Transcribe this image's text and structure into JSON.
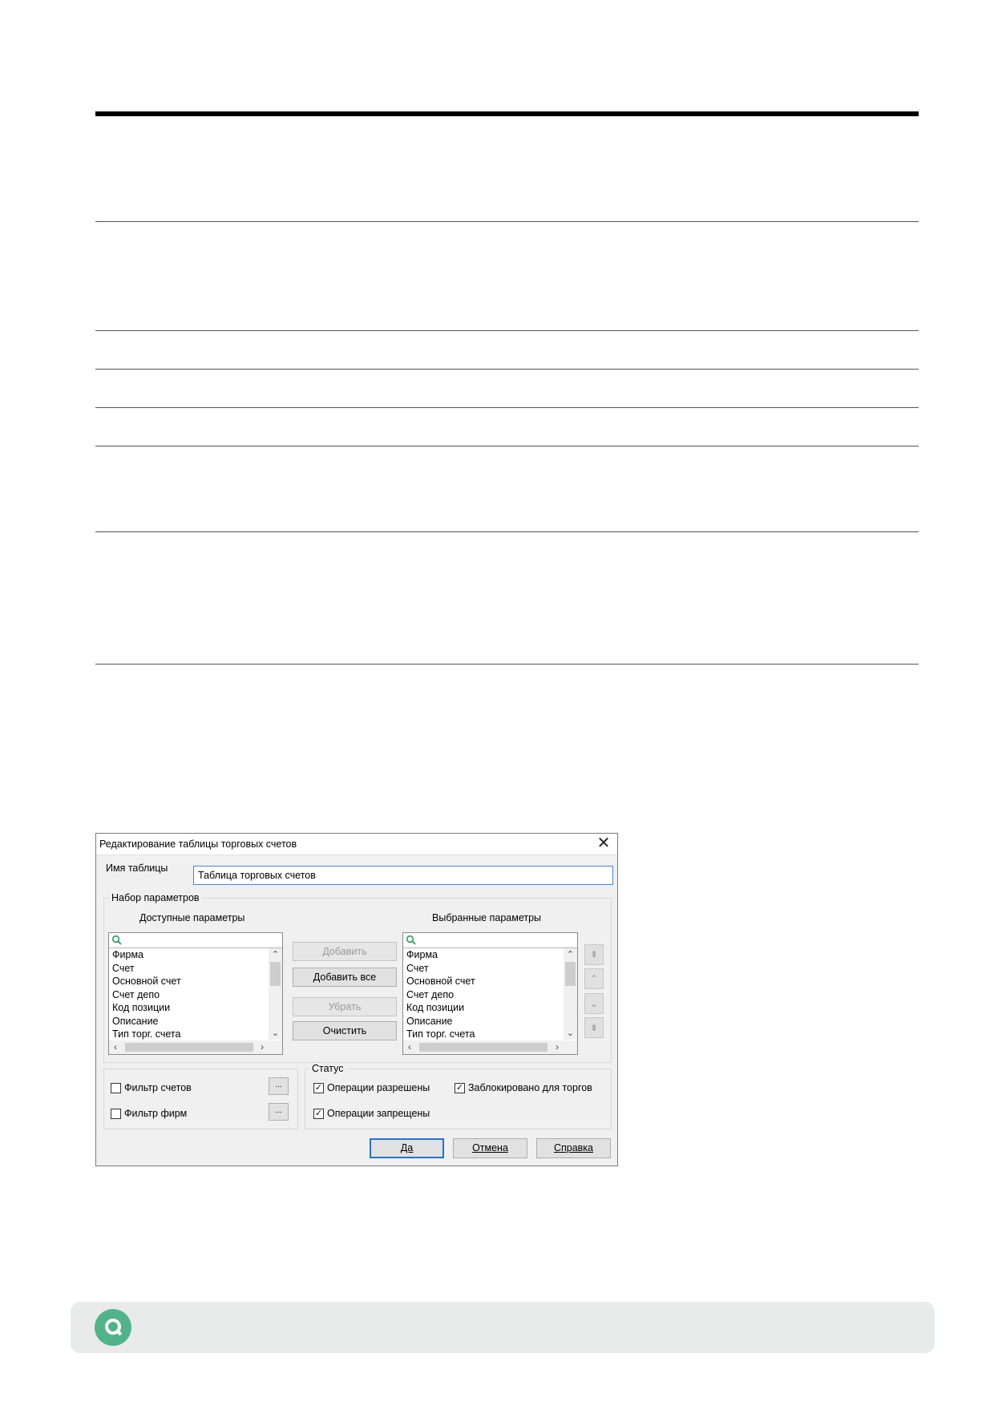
{
  "dialog": {
    "title": "Редактирование таблицы торговых счетов",
    "close_icon": "close-icon",
    "table_name_label": "Имя таблицы",
    "table_name_value": "Таблица торговых счетов",
    "params_group_label": "Набор параметров",
    "available_label": "Доступные параметры",
    "selected_label": "Выбранные параметры",
    "available_items": [
      "Фирма",
      "Счет",
      "Основной счет",
      "Счет депо",
      "Код позиции",
      "Описание",
      "Тип торг. счета"
    ],
    "selected_items": [
      "Фирма",
      "Счет",
      "Основной счет",
      "Счет депо",
      "Код позиции",
      "Описание",
      "Тип торг. счета"
    ],
    "buttons": {
      "add": "Добавить",
      "add_all": "Добавить все",
      "remove": "Убрать",
      "clear": "Очистить",
      "ok": "Да",
      "cancel": "Отмена",
      "help": "Справка",
      "ellipsis": "..."
    },
    "filters": {
      "accounts": "Фильтр счетов",
      "firms": "Фильтр фирм"
    },
    "status": {
      "label": "Статус",
      "ops_allowed": "Операции разрешены",
      "ops_allowed_checked": true,
      "blocked": "Заблокировано для торгов",
      "blocked_checked": true,
      "ops_forbidden": "Операции запрещены",
      "ops_forbidden_checked": true
    }
  },
  "footer": {
    "logo_icon": "q-logo-icon",
    "brand_color": "#52b38a"
  }
}
